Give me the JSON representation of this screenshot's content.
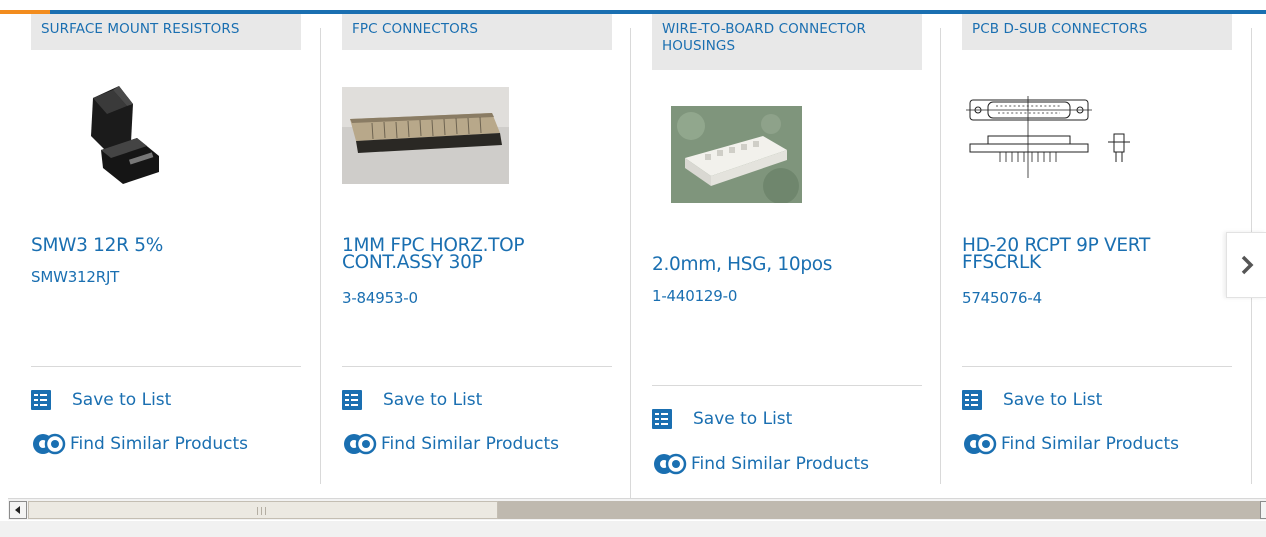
{
  "colors": {
    "brand_blue": "#1a6fb1",
    "accent_orange": "#f28c1e",
    "tag_background": "#e8e8e8",
    "divider": "#d9d9d9"
  },
  "products": [
    {
      "category": "SURFACE MOUNT RESISTORS",
      "name": "SMW3 12R 5%",
      "part_number": "SMW312RJT",
      "image": "black-smd-resistor-photo",
      "save_label": "Save to List",
      "similar_label": "Find Similar Products"
    },
    {
      "category": "FPC CONNECTORS",
      "name": "1MM FPC HORZ.TOP CONT.ASSY 30P",
      "part_number": "3-84953-0",
      "image": "fpc-connector-photo",
      "save_label": "Save to List",
      "similar_label": "Find Similar Products"
    },
    {
      "category": "WIRE-TO-BOARD CONNECTOR HOUSINGS",
      "name": "2.0mm, HSG, 10pos",
      "part_number": "1-440129-0",
      "image": "white-housing-photo",
      "save_label": "Save to List",
      "similar_label": "Find Similar Products"
    },
    {
      "category": "PCB D-SUB CONNECTORS",
      "name": "HD-20 RCPT 9P VERT FFSCRLK",
      "part_number": "5745076-4",
      "image": "d-sub-line-drawing",
      "save_label": "Save to List",
      "similar_label": "Find Similar Products"
    }
  ],
  "icons": {
    "save": "save-to-list-icon",
    "similar": "find-similar-gear-icon",
    "next": "chevron-right-icon"
  },
  "scrollbar": {
    "grip_label": "III"
  }
}
